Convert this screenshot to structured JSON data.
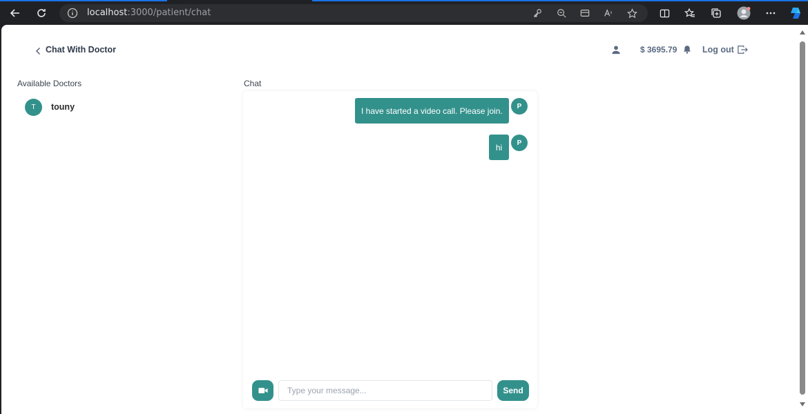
{
  "browser": {
    "url_host": "localhost",
    "url_path": ":3000/patient/chat"
  },
  "header": {
    "title": "Chat With Doctor",
    "balance": "$ 3695.79",
    "logout_label": "Log out"
  },
  "sidebar": {
    "label": "Available Doctors",
    "doctors": [
      {
        "initial": "T",
        "name": "touny"
      }
    ]
  },
  "chat": {
    "label": "Chat",
    "messages": [
      {
        "text": "I have started a video call. Please join.",
        "sender_initial": "P"
      },
      {
        "text": "hi",
        "sender_initial": "P"
      }
    ],
    "input_placeholder": "Type your message...",
    "send_label": "Send"
  },
  "colors": {
    "accent": "#33918c",
    "browser_chrome": "#202124"
  }
}
